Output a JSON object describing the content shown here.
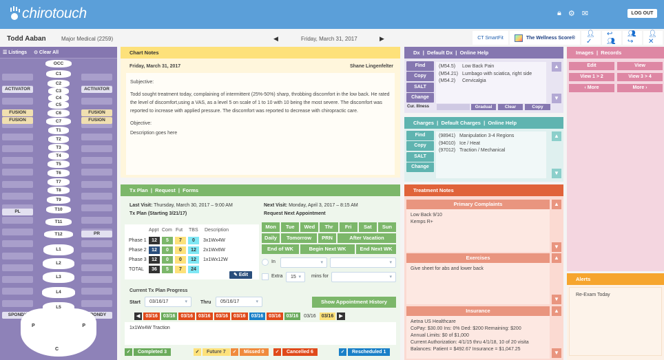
{
  "app": {
    "logo": "chirotouch",
    "logout": "LOG OUT",
    "icons": [
      "lock-icon",
      "gear-icon",
      "mail-icon"
    ]
  },
  "patient": {
    "name": "Todd Aaban",
    "insurance": "Major Medical (2259)",
    "date": "Friday, March 31, 2017"
  },
  "toolbar": {
    "smartfit": "CT SmartFit",
    "wellness": "The Wellness Score®"
  },
  "spine": {
    "header": {
      "listings": "Listings",
      "clear_all": "Clear All"
    },
    "vertebrae": [
      "OCC",
      "C1",
      "C2",
      "C3",
      "C4",
      "C5",
      "C6",
      "C7",
      "T1",
      "T2",
      "T3",
      "T4",
      "T5",
      "T6",
      "T7",
      "T8",
      "T9",
      "T10",
      "T11",
      "T12",
      "L1",
      "L2",
      "L3",
      "L4",
      "L5"
    ],
    "pelvis": {
      "left": "P",
      "right": "P",
      "coccyx": "C"
    },
    "left_tags": {
      "C1": "ACTIVATOR",
      "C4": "FUSION",
      "C5": "FUSION",
      "T9": "PL",
      "L5": "SPONDY"
    },
    "right_tags": {
      "C1": "ACTIVATOR",
      "C4": "FUSION",
      "C5": "FUSION",
      "T11": "PR",
      "L5": "SPONDY"
    }
  },
  "chart_notes": {
    "title": "Chart Notes",
    "date": "Friday, March 31, 2017",
    "provider": "Shane Lingenfelter",
    "subjective_label": "Subjective:",
    "subjective": "Todd sought treatment today, complaining of intermittent (25%-50%) sharp, throbbing discomfort in the low back. He rated the level of discomfort,using a VAS, as a level 5 on scale of 1 to 10 with 10 being the most severe. The discomfort was reported to increase with applied pressure. The discomfort was reported to decrease with chiropractic care.",
    "objective_label": "Objective:",
    "objective": "Description goes here"
  },
  "txplan": {
    "tabs": [
      "Tx Plan",
      "Request",
      "Forms"
    ],
    "last_visit_label": "Last Visit:",
    "last_visit": "Thursday, March 30, 2017  –  9:00 AM",
    "plan_label": "Tx Plan (Starting 3/21/17)",
    "next_visit_label": "Next Visit:",
    "next_visit": "Monday, April 3, 2017  –  8:15 AM",
    "request_label": "Request Next Appointment",
    "columns": [
      "Appt",
      "Com",
      "Fut",
      "TBS",
      "Description"
    ],
    "rows": [
      {
        "name": "Phase 1",
        "appt": "12",
        "com": "5",
        "fut": "7",
        "tbs": "0",
        "desc": "3x1Wx4W"
      },
      {
        "name": "Phase 2",
        "appt": "12",
        "com": "0",
        "fut": "0",
        "tbs": "12",
        "desc": "2x1Wx6W"
      },
      {
        "name": "Phase 3",
        "appt": "12",
        "com": "0",
        "fut": "0",
        "tbs": "12",
        "desc": "1x1Wx12W"
      },
      {
        "name": "TOTAL",
        "appt": "36",
        "com": "5",
        "fut": "7",
        "tbs": "24",
        "desc": ""
      }
    ],
    "edit": "Edit",
    "days": [
      "Mon",
      "Tue",
      "Wed",
      "Thr",
      "Fri",
      "Sat",
      "Sun"
    ],
    "quick": [
      "Daily",
      "Tomorrow",
      "PRN",
      "After Vacation"
    ],
    "weeks": [
      "End of WK",
      "Begin Next WK",
      "End Next WK"
    ],
    "in_label": "In",
    "extra_label": "Extra",
    "extra_value": "15",
    "mins_for": "mins for",
    "progress_label": "Current Tx Plan Progress",
    "start_label": "Start",
    "start": "03/16/17",
    "thru_label": "Thru",
    "thru": "05/16/17",
    "history_btn": "Show Appointment History",
    "visits": [
      {
        "d": "03/16",
        "c": "#e04a1a"
      },
      {
        "d": "03/16",
        "c": "#6aab5c"
      },
      {
        "d": "03/16",
        "c": "#e04a1a"
      },
      {
        "d": "03/16",
        "c": "#e04a1a"
      },
      {
        "d": "03/16",
        "c": "#e04a1a"
      },
      {
        "d": "03/16",
        "c": "#e04a1a"
      },
      {
        "d": "03/16",
        "c": "#1a80c8"
      },
      {
        "d": "03/16",
        "c": "#e04a1a"
      },
      {
        "d": "03/16",
        "c": "#6aab5c"
      },
      {
        "d": "03/16",
        "c": "none"
      },
      {
        "d": "03/16",
        "c": "#fde17a"
      }
    ],
    "visit_note": "1x1Wx4W Traction",
    "legend": [
      {
        "label": "Completed",
        "count": "3",
        "color": "#6aab5c"
      },
      {
        "label": "Future",
        "count": "7",
        "color": "#fde17a"
      },
      {
        "label": "Missed",
        "count": "0",
        "color": "#f08a3c"
      },
      {
        "label": "Cancelled",
        "count": "6",
        "color": "#e04a1a"
      },
      {
        "label": "Rescheduled",
        "count": "1",
        "color": "#1a80c8"
      }
    ]
  },
  "dx": {
    "tabs": [
      "Dx",
      "Default Dx",
      "Online Help"
    ],
    "buttons": [
      "Find",
      "Copy",
      "SALT",
      "Change"
    ],
    "items": [
      {
        "code": "(M54.5)",
        "desc": "Low Back Pain"
      },
      {
        "code": "(M54.21)",
        "desc": "Lumbago with sciatica, right side"
      },
      {
        "code": "(M54.2)",
        "desc": "Cervicalgia"
      }
    ],
    "cur_illness": "Cur. Illness",
    "gradual": "Gradual",
    "clear": "Clear",
    "copy": "Copy"
  },
  "charges": {
    "tabs": [
      "Charges",
      "Default Charges",
      "Online Help"
    ],
    "buttons": [
      "Find",
      "Copy",
      "SALT",
      "Change"
    ],
    "items": [
      {
        "code": "(98941)",
        "desc": "Manipulation 3-4 Regions"
      },
      {
        "code": "(94010)",
        "desc": "Ice / Heat"
      },
      {
        "code": "(97012)",
        "desc": "Traction / Mechanical"
      }
    ]
  },
  "treatment_notes": {
    "title": "Treatment Notes",
    "primary_title": "Primary Complaints",
    "primary": [
      "Low Back   9/10",
      "Kemps R+"
    ],
    "exercises_title": "Exercises",
    "exercises": "Give sheet for abs and lower back",
    "insurance_title": "Insurance",
    "insurance": [
      "Aetna US Healthcare",
      "CoPay: $30.00   Ins: 0%   Ded: $200   Remaining: $200",
      "Annual Limits:  $0 of $1,000",
      "Current Authorization: 4/1/15 thru 4/1/18, 10 of 20 visita",
      "Balances:   Patient = $492.67   Insurance = $1,047.25"
    ]
  },
  "images": {
    "tabs": [
      "Images",
      "Records"
    ],
    "buttons": [
      "Edit",
      "View",
      "View 1 > 2",
      "View 3 > 4",
      "‹ More",
      "More ›"
    ]
  },
  "alerts": {
    "title": "Alerts",
    "text": "Re-Exam Today"
  }
}
